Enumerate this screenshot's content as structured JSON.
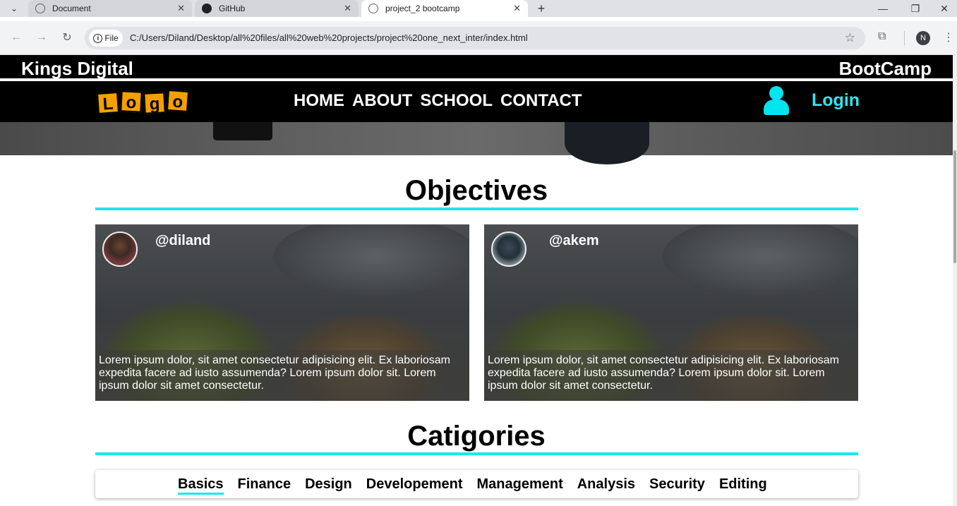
{
  "browser": {
    "tabs": [
      {
        "title": "Document",
        "icon": "globe-icon",
        "state": "inactive"
      },
      {
        "title": "GitHub",
        "icon": "github-icon",
        "state": "inactive"
      },
      {
        "title": "project_2 bootcamp",
        "icon": "globe-icon",
        "state": "active"
      }
    ],
    "address": {
      "chip_label": "File",
      "url": "C:/Users/Diland/Desktop/all%20files/all%20web%20projects/project%20one_next_inter/index.html"
    },
    "profile_initial": "N"
  },
  "site": {
    "brand_left": "Kings Digital",
    "brand_right": "BootCamp",
    "logo_letters": [
      "L",
      "o",
      "g",
      "o"
    ],
    "nav": [
      "HOME",
      "ABOUT",
      "SCHOOL",
      "CONTACT"
    ],
    "login_label": "Login",
    "accent_color": "#1ee6ee",
    "logo_color": "#f5a000"
  },
  "objectives": {
    "title": "Objectives",
    "cards": [
      {
        "handle": "@diland",
        "text": "Lorem ipsum dolor, sit amet consectetur adipisicing elit. Ex laboriosam expedita facere ad iusto assumenda? Lorem ipsum dolor sit. Lorem ipsum dolor sit amet consectetur."
      },
      {
        "handle": "@akem",
        "text": "Lorem ipsum dolor, sit amet consectetur adipisicing elit. Ex laboriosam expedita facere ad iusto assumenda? Lorem ipsum dolor sit. Lorem ipsum dolor sit amet consectetur."
      }
    ]
  },
  "categories": {
    "title": "Catigories",
    "items": [
      "Basics",
      "Finance",
      "Design",
      "Developement",
      "Management",
      "Analysis",
      "Security",
      "Editing"
    ],
    "active": "Basics"
  }
}
